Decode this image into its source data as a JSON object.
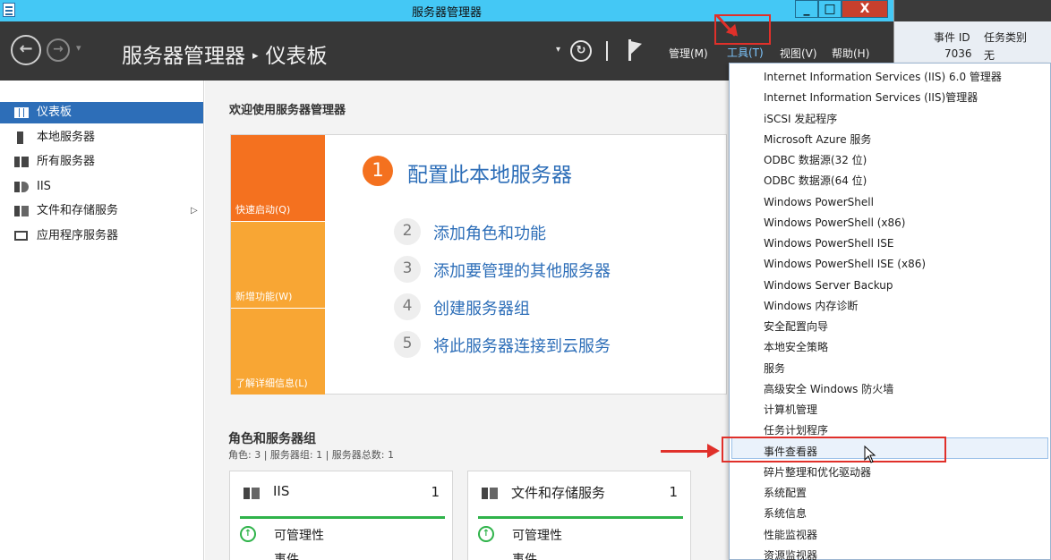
{
  "window": {
    "title": "服务器管理器",
    "min_label": "_",
    "max_label": "□",
    "close_label": "X"
  },
  "header": {
    "back_glyph": "←",
    "forward_glyph": "→",
    "dropdown_glyph": "▾",
    "breadcrumb_app": "服务器管理器",
    "breadcrumb_sep": "▸",
    "breadcrumb_page": "仪表板",
    "refresh_glyph": "↻",
    "menus": {
      "manage": "管理(M)",
      "tools": "工具(T)",
      "view": "视图(V)",
      "help": "帮助(H)"
    }
  },
  "sidebar": {
    "items": [
      {
        "label": "仪表板",
        "icon": "dashboard-icon",
        "active": true
      },
      {
        "label": "本地服务器",
        "icon": "server-icon"
      },
      {
        "label": "所有服务器",
        "icon": "servers-icon"
      },
      {
        "label": "IIS",
        "icon": "iis-icon"
      },
      {
        "label": "文件和存储服务",
        "icon": "storage-icon"
      },
      {
        "label": "应用程序服务器",
        "icon": "app-server-icon"
      }
    ],
    "expand_glyph": "▷"
  },
  "main": {
    "welcome_title": "欢迎使用服务器管理器",
    "tiles": {
      "quickstart": "快速启动(Q)",
      "whatsnew": "新增功能(W)",
      "learnmore": "了解详细信息(L)"
    },
    "steps": [
      {
        "num": "1",
        "label": "配置此本地服务器"
      },
      {
        "num": "2",
        "label": "添加角色和功能"
      },
      {
        "num": "3",
        "label": "添加要管理的其他服务器"
      },
      {
        "num": "4",
        "label": "创建服务器组"
      },
      {
        "num": "5",
        "label": "将此服务器连接到云服务"
      }
    ],
    "roles_title": "角色和服务器组",
    "roles_summary": "角色: 3 | 服务器组: 1 | 服务器总数: 1",
    "cards": [
      {
        "title": "IIS",
        "count": "1",
        "status": "可管理性",
        "next": "事件"
      },
      {
        "title": "文件和存储服务",
        "count": "1",
        "status": "可管理性",
        "next": "事件"
      }
    ]
  },
  "tools_menu": {
    "items": [
      "Internet Information Services (IIS) 6.0 管理器",
      "Internet Information Services (IIS)管理器",
      "iSCSI 发起程序",
      "Microsoft Azure 服务",
      "ODBC 数据源(32 位)",
      "ODBC 数据源(64 位)",
      "Windows PowerShell",
      "Windows PowerShell (x86)",
      "Windows PowerShell ISE",
      "Windows PowerShell ISE (x86)",
      "Windows Server Backup",
      "Windows 内存诊断",
      "安全配置向导",
      "本地安全策略",
      "服务",
      "高级安全 Windows 防火墙",
      "计算机管理",
      "任务计划程序",
      "事件查看器",
      "碎片整理和优化驱动器",
      "系统配置",
      "系统信息",
      "性能监视器",
      "资源监视器"
    ],
    "highlighted": "事件查看器"
  },
  "background_window": {
    "col_event_id": "事件 ID",
    "col_task_category": "任务类别",
    "row_event_id": "7036",
    "row_task_category": "无"
  },
  "colors": {
    "titlebar": "#44c8f5",
    "header": "#373737",
    "accent": "#2d6eb8",
    "quickstart": "#f4711f",
    "tile": "#f8a634",
    "annotation": "#e0302a",
    "ok": "#2fb34a"
  }
}
